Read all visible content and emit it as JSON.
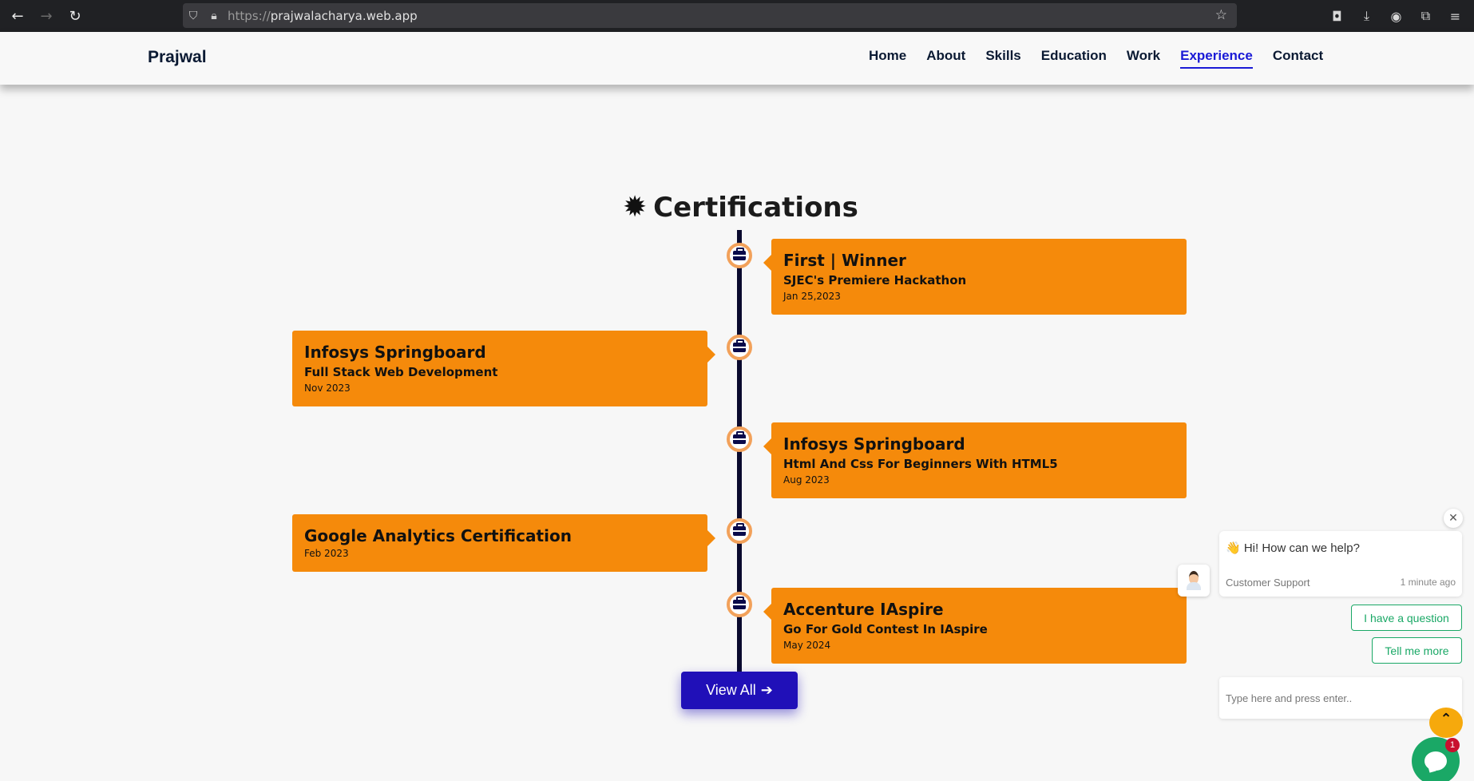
{
  "browser": {
    "url_protocol": "https://",
    "url_host": "prajwalacharya.web.app",
    "icons": [
      "back-arrow-icon",
      "forward-arrow-icon",
      "reload-icon",
      "shield-icon",
      "lock-icon",
      "star-icon",
      "pocket-icon",
      "download-icon",
      "account-icon",
      "extensions-icon",
      "menu-icon"
    ]
  },
  "header": {
    "brand": "Prajwal",
    "nav": [
      {
        "label": "Home",
        "active": false
      },
      {
        "label": "About",
        "active": false
      },
      {
        "label": "Skills",
        "active": false
      },
      {
        "label": "Education",
        "active": false
      },
      {
        "label": "Work",
        "active": false
      },
      {
        "label": "Experience",
        "active": true
      },
      {
        "label": "Contact",
        "active": false
      }
    ]
  },
  "certifications": {
    "title": "Certifications",
    "icon": "certificate-badge-icon",
    "items": [
      {
        "title": "First | Winner",
        "subtitle": "SJEC's Premiere Hackathon",
        "date": "Jan 25,2023",
        "side": "right"
      },
      {
        "title": "Infosys Springboard",
        "subtitle": "Full Stack Web Development",
        "date": "Nov 2023",
        "side": "left"
      },
      {
        "title": "Infosys Springboard",
        "subtitle": "Html And Css For Beginners With HTML5",
        "date": "Aug 2023",
        "side": "right"
      },
      {
        "title": "Google Analytics Certification",
        "subtitle": "",
        "date": "Feb 2023",
        "side": "left"
      },
      {
        "title": "Accenture IAspire",
        "subtitle": "Go For Gold Contest In IAspire",
        "date": "May 2024",
        "side": "right"
      }
    ],
    "view_all_label": "View All",
    "view_all_icon": "arrow-right-icon"
  },
  "chat": {
    "greeting": "👋 Hi! How can we help?",
    "agent_name": "Customer Support",
    "timestamp": "1 minute ago",
    "quick_replies": [
      "I have a question",
      "Tell me more"
    ],
    "input_placeholder": "Type here and press enter..",
    "unread_count": "1",
    "accent_color": "#1aa866"
  },
  "colors": {
    "card": "#f58a0b",
    "nav_active": "#1a1ad6",
    "button": "#2010b8",
    "timeline": "#0a0a2e"
  }
}
